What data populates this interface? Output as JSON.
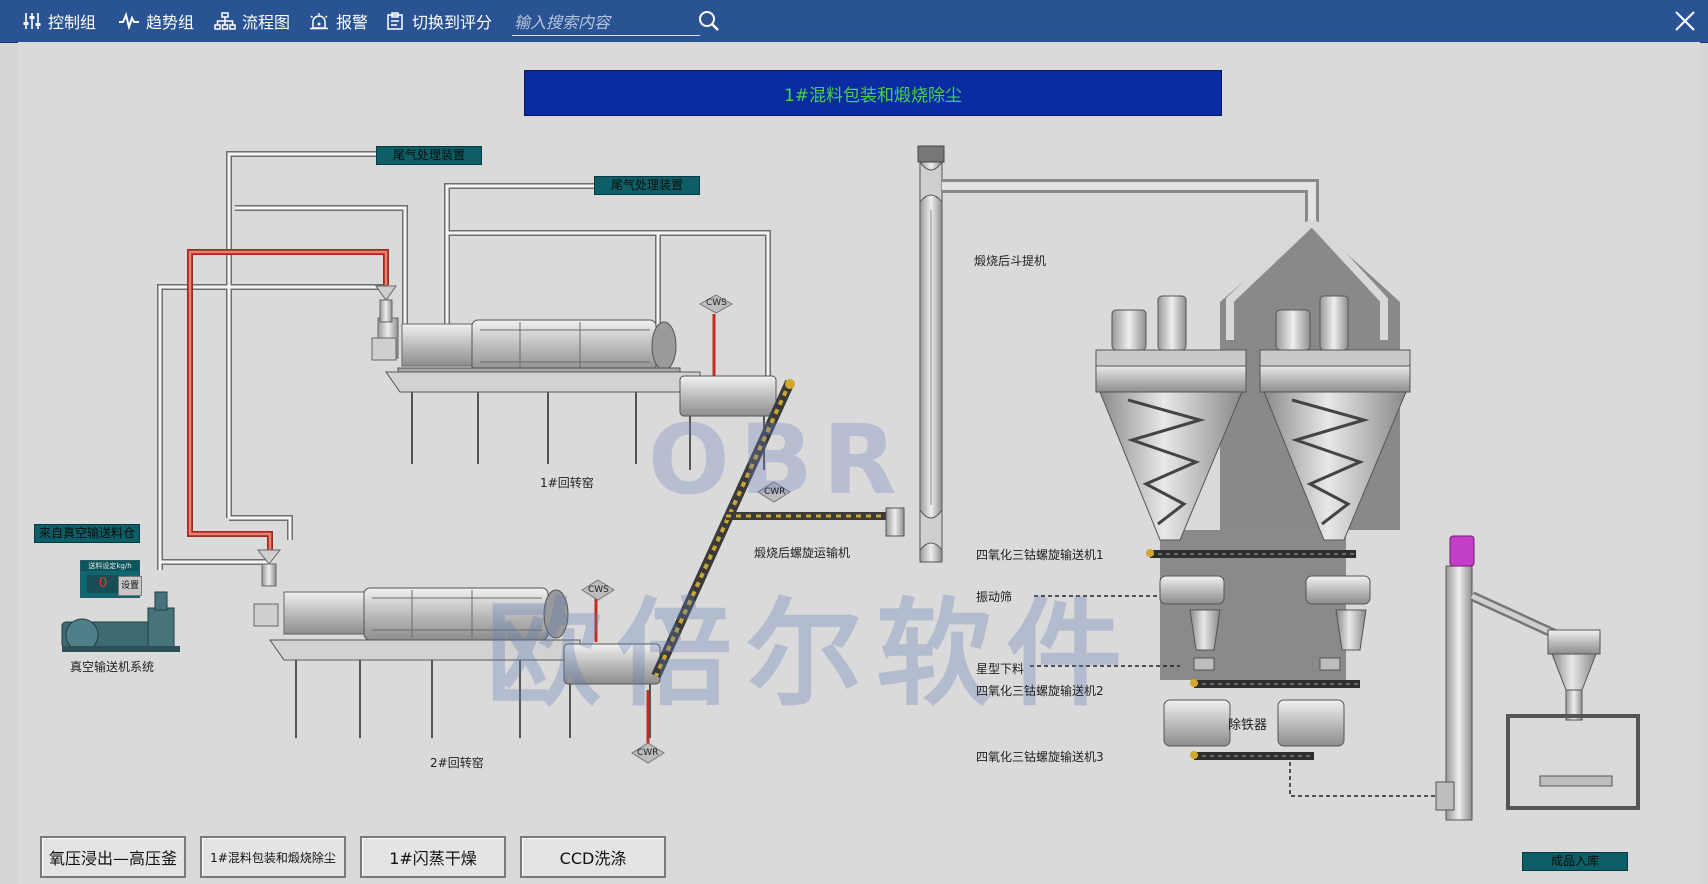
{
  "nav": {
    "items": [
      {
        "label": "控制组",
        "icon": "sliders-icon"
      },
      {
        "label": "趋势组",
        "icon": "pulse-icon"
      },
      {
        "label": "流程图",
        "icon": "sitemap-icon"
      },
      {
        "label": "报警",
        "icon": "alarm-icon"
      },
      {
        "label": "切换到评分",
        "icon": "clipboard-icon"
      }
    ],
    "search_placeholder": "输入搜索内容"
  },
  "page_title": "1#混料包装和煅烧除尘",
  "tags": {
    "exhaust_1": "尾气处理装置",
    "exhaust_2": "尾气处理装置",
    "vacuum_source": "来自真空输送料仓",
    "finished_storage": "成品入库"
  },
  "control_panel": {
    "setpoint_label": "送料设定kg/h",
    "value": "0",
    "set_button": "设置"
  },
  "labels": {
    "vacuum_system": "真空输送机系统",
    "kiln_1": "1#回转窑",
    "kiln_2": "2#回转窑",
    "screw_conveyor": "煅烧后螺旋运输机",
    "bucket_elevator": "煅烧后斗提机",
    "conveyor_1": "四氧化三钴螺旋输送机1",
    "conveyor_2": "四氧化三钴螺旋输送机2",
    "conveyor_3": "四氧化三钴螺旋输送机3",
    "vibrating_screen": "振动筛",
    "star_valve": "星型下料",
    "iron_remover": "除铁器",
    "cws_1": "CWS",
    "cwr_1": "CWR",
    "cws_2": "CWS",
    "cwr_2": "CWR"
  },
  "watermark": {
    "logo": "OBR",
    "text": "欧倍尔软件"
  },
  "bottom_buttons": [
    "氧压浸出—高压釜",
    "1#混料包装和煅烧除尘",
    "1#闪蒸干燥",
    "CCD洗涤"
  ],
  "colors": {
    "topbar": "#2a5393",
    "banner_bg": "#0b2ba3",
    "banner_text": "#46d14a",
    "tag_bg": "#0d5e66",
    "hot_pipe": "#d23a2a",
    "pipe": "#f4f4f4"
  }
}
